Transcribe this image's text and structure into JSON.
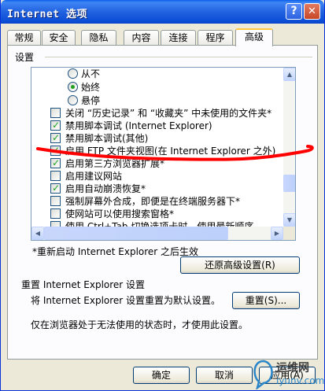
{
  "window": {
    "title": "Internet 选项"
  },
  "tabs": [
    "常规",
    "安全",
    "隐私",
    "内容",
    "连接",
    "程序",
    "高级"
  ],
  "active_tab": "高级",
  "settings": {
    "group_label": "设置",
    "items": [
      {
        "type": "radio",
        "checked": false,
        "label": "从不"
      },
      {
        "type": "radio",
        "checked": true,
        "label": "始终"
      },
      {
        "type": "radio",
        "checked": false,
        "label": "悬停"
      },
      {
        "type": "checkbox",
        "checked": false,
        "label": "关闭 “历史记录” 和 “收藏夹” 中未使用的文件夹*"
      },
      {
        "type": "checkbox",
        "checked": true,
        "label": "禁用脚本调试 (Internet Explorer)"
      },
      {
        "type": "checkbox",
        "checked": true,
        "label": "禁用脚本调试(其他)"
      },
      {
        "type": "checkbox",
        "checked": true,
        "label": "启用 FTP 文件夹视图(在 Internet Explorer 之外)"
      },
      {
        "type": "checkbox",
        "checked": true,
        "label": "启用第三方浏览器扩展*"
      },
      {
        "type": "checkbox",
        "checked": false,
        "label": "启用建议网站"
      },
      {
        "type": "checkbox",
        "checked": true,
        "label": "启用自动崩溃恢复*"
      },
      {
        "type": "checkbox",
        "checked": false,
        "label": "强制屏幕外合成，即便是在终端服务器下*"
      },
      {
        "type": "checkbox",
        "checked": false,
        "label": "使网站可以使用搜索窗格*"
      },
      {
        "type": "checkbox",
        "checked": false,
        "label": "使用 Ctrl+Tab 切换选项卡时，使用最新顺序"
      }
    ],
    "restart_note": "*重新启动 Internet Explorer 之后生效",
    "restore_button": "还原高级设置(R)"
  },
  "reset": {
    "title": "重置 Internet Explorer 设置",
    "description": "将 Internet Explorer 设置重置为默认设置。",
    "button": "重置(S)...",
    "hint": "仅在浏览器处于无法使用的状态时，才使用此设置。"
  },
  "footer": {
    "ok": "确定",
    "cancel": "取消",
    "apply": "应用(A)"
  },
  "watermark": {
    "line1": "运维网",
    "line2": "iyunv.com"
  },
  "colors": {
    "title_bar": "#0a5ee8",
    "annotation": "#ff0000",
    "check": "#21a121"
  }
}
